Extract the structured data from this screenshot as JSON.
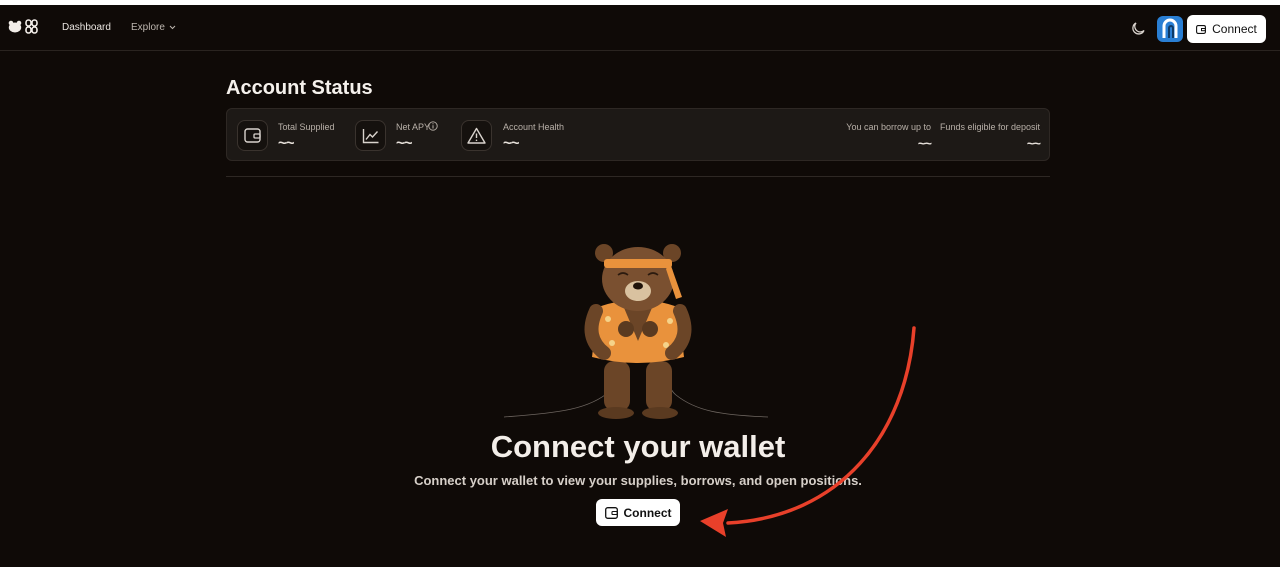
{
  "header": {
    "nav": {
      "dashboard": "Dashboard",
      "explore": "Explore"
    },
    "connect_label": "Connect"
  },
  "account_status": {
    "title": "Account Status",
    "stats": {
      "total_supplied": {
        "label": "Total Supplied",
        "value": "~~"
      },
      "net_apy": {
        "label": "Net APY",
        "value": "~~"
      },
      "account_health": {
        "label": "Account Health",
        "value": "~~"
      },
      "borrow_up_to": {
        "label": "You can borrow up to",
        "value": "~~"
      },
      "funds_eligible": {
        "label": "Funds eligible for deposit",
        "value": "~~"
      }
    }
  },
  "empty_state": {
    "title": "Connect your wallet",
    "subtitle": "Connect your wallet to view your supplies, borrows, and open positions.",
    "connect_label": "Connect"
  },
  "icons": {
    "logo": "bear-logo-icon",
    "chain": "chain-link-icon",
    "theme": "moon-icon",
    "wallet": "wallet-icon",
    "chart": "line-chart-icon",
    "warning": "warning-icon",
    "info": "info-icon"
  },
  "colors": {
    "background": "#0f0a07",
    "card": "#1d1916",
    "button": "#ffffff",
    "annotation_arrow": "#e8402a",
    "avatar": "#2a7fd4"
  }
}
